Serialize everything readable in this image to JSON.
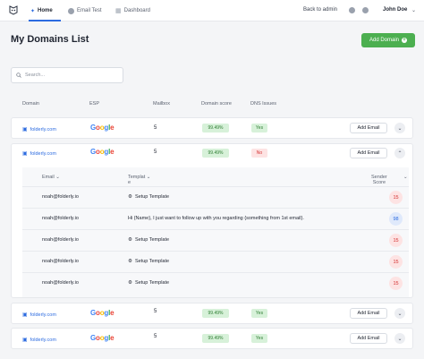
{
  "nav": {
    "home": "Home",
    "email_test": "Email Test",
    "dashboard": "Dashboard",
    "back_to_admin": "Back to admin",
    "user": "John Doe",
    "icons": [
      "info-icon",
      "bell-icon"
    ]
  },
  "page": {
    "title": "My Domains List",
    "add_domain": "Add Domain",
    "search_placeholder": "Search..."
  },
  "columns": {
    "domain": "Domain",
    "esp": "ESP",
    "mailbox": "Mailbox",
    "domain_score": "Domain score",
    "dns_issues": "DNS Issues"
  },
  "domains": [
    {
      "name": "folderly.com",
      "esp": "Google",
      "mailbox": "5",
      "score": "99.49%",
      "dns": "Yes",
      "add": "Add Email"
    },
    {
      "name": "folderly.com",
      "esp": "Google",
      "mailbox": "5",
      "score": "99.49%",
      "dns": "No",
      "add": "Add Email"
    },
    {
      "name": "folderly.com",
      "esp": "Google",
      "mailbox": "5",
      "score": "99.49%",
      "dns": "Yes",
      "add": "Add Email"
    },
    {
      "name": "folderly.com",
      "esp": "Google",
      "mailbox": "5",
      "score": "99.49%",
      "dns": "Yes",
      "add": "Add Email"
    }
  ],
  "sub_table": {
    "email_header": "Email",
    "template_header_1": "Templat",
    "template_header_2": "e",
    "sender_header_1": "Sender",
    "sender_header_2": "Score",
    "rows": [
      {
        "email": "noah@folderly.io",
        "template": "Setup Template",
        "score": "15"
      },
      {
        "email": "noah@folderly.io",
        "template": "Hi {Name}, I just want to follow up with you regarding {something from 1st email}.",
        "score": "98"
      },
      {
        "email": "noah@folderly.io",
        "template": "Setup Template",
        "score": "15"
      },
      {
        "email": "noah@folderly.io",
        "template": "Setup Template",
        "score": "15"
      },
      {
        "email": "noah@folderly.io",
        "template": "Setup Template",
        "score": "15"
      }
    ]
  },
  "colors": {
    "accent": "#2c6be0",
    "success": "#4caf50",
    "danger": "#d32f2f"
  }
}
